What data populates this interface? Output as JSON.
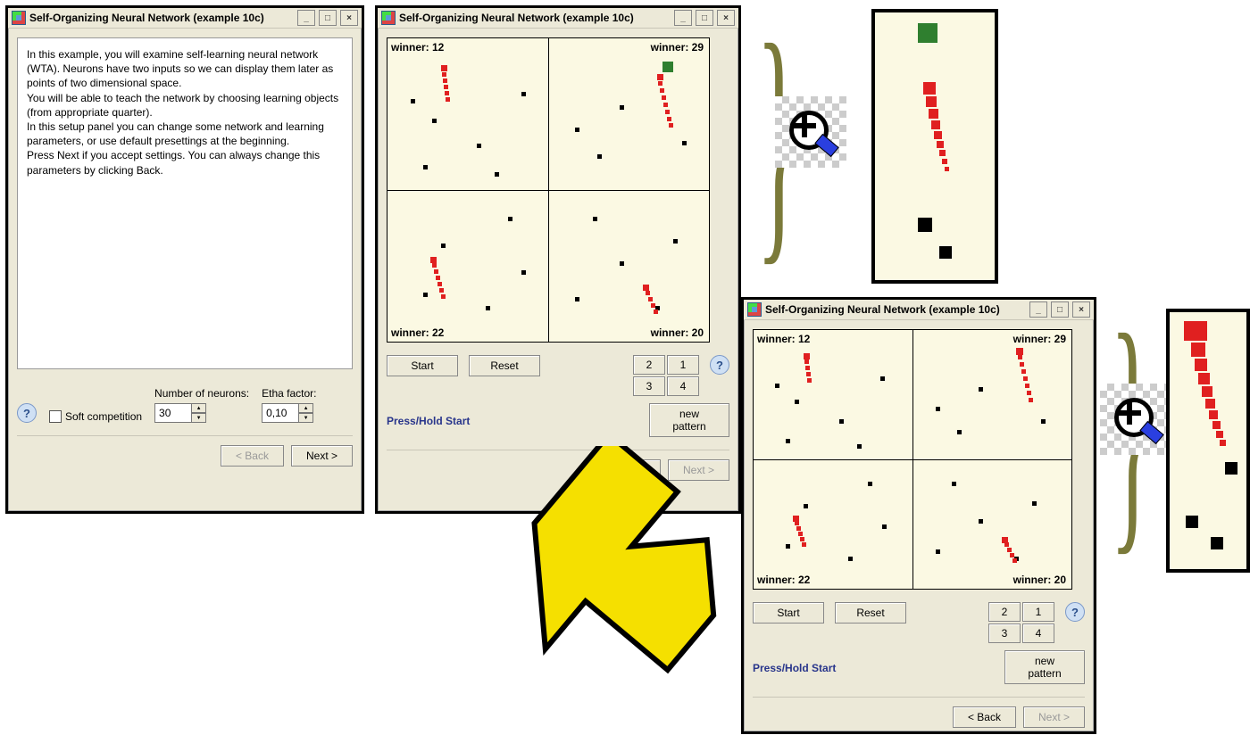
{
  "title": "Self-Organizing Neural Network (example 10c)",
  "intro": {
    "p1": "In this example, you will examine self-learning neural network (WTA). Neurons have two inputs so we can display them later as points of two dimensional space.",
    "p2": "You will be able to teach the network by choosing learning objects (from appropriate quarter).",
    "p3": "In this setup panel you can change some network and learning parameters, or use default presettings at the beginning.",
    "p4": "Press Next if you accept settings. You can always change this parameters by clicking Back."
  },
  "settings": {
    "soft_label": "Soft competition",
    "num_neurons_label": "Number of neurons:",
    "num_neurons_value": "30",
    "etha_label": "Etha factor:",
    "etha_value": "0,10"
  },
  "nav": {
    "back": "< Back",
    "next": "Next >"
  },
  "plot": {
    "winner12": "winner: 12",
    "winner29": "winner: 29",
    "winner22": "winner: 22",
    "winner20": "winner: 20",
    "start": "Start",
    "reset": "Reset",
    "press_hold": "Press/Hold Start",
    "new_pattern": "new pattern",
    "q1": "1",
    "q2": "2",
    "q3": "3",
    "q4": "4"
  }
}
